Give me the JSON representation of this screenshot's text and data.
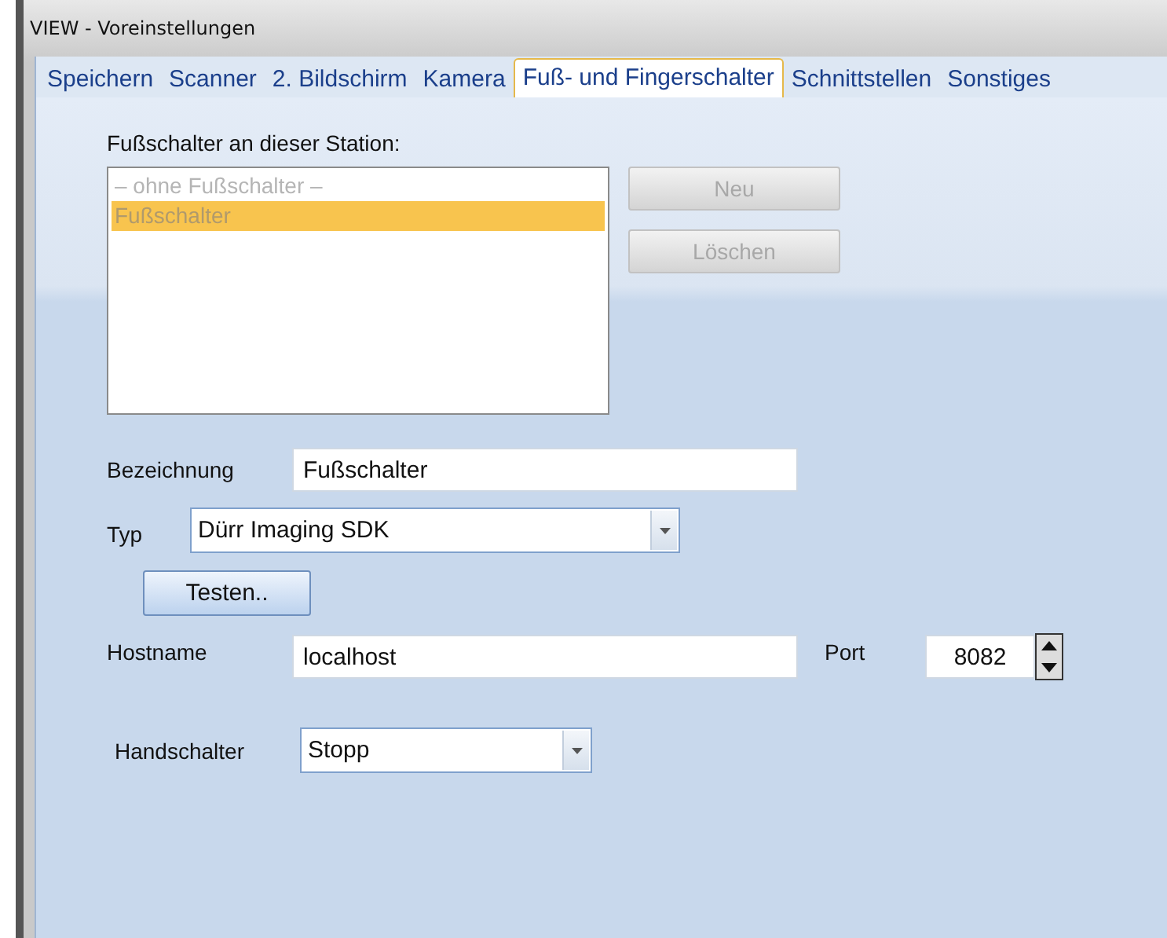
{
  "window": {
    "title": "VIEW - Voreinstellungen"
  },
  "tabs": [
    {
      "label": "Speichern",
      "selected": false
    },
    {
      "label": "Scanner",
      "selected": false
    },
    {
      "label": "2. Bildschirm",
      "selected": false
    },
    {
      "label": "Kamera",
      "selected": false
    },
    {
      "label": "Fuß- und Fingerschalter",
      "selected": true
    },
    {
      "label": "Schnittstellen",
      "selected": false
    },
    {
      "label": "Sonstiges",
      "selected": false
    }
  ],
  "footswitch_list": {
    "label": "Fußschalter an dieser Station:",
    "disabled": true,
    "items": [
      {
        "label": "– ohne Fußschalter –",
        "selected": false
      },
      {
        "label": "Fußschalter",
        "selected": true
      }
    ]
  },
  "buttons": [
    {
      "label": "Neu",
      "disabled": true
    },
    {
      "label": "Löschen",
      "disabled": true
    }
  ],
  "bezeichnung": {
    "label": "Bezeichnung",
    "value": "Fußschalter"
  },
  "typ": {
    "label": "Typ",
    "value": "Dürr Imaging SDK"
  },
  "test_button": {
    "label": "Testen..",
    "disabled": false
  },
  "hostname": {
    "label": "Hostname",
    "value": "localhost"
  },
  "port": {
    "label": "Port",
    "value": "8082"
  },
  "handschalter": {
    "label": "Handschalter",
    "value": "Stopp"
  }
}
